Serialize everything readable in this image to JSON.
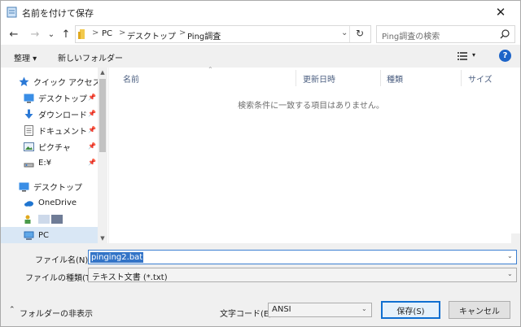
{
  "window": {
    "title": "名前を付けて保存"
  },
  "nav": {
    "back_glyph": "←",
    "forward_glyph": "→",
    "recent_glyph": "⌄",
    "up_glyph": "↑",
    "breadcrumb": [
      "PC",
      "デスクトップ",
      "Ping調査"
    ],
    "breadcrumb_sep": ">",
    "dropdown_glyph": "⌄",
    "refresh_glyph": "↻",
    "search_placeholder": "Ping調査の検索"
  },
  "toolbar": {
    "organize": "整理 ▾",
    "new_folder": "新しいフォルダー",
    "view_caret": "▾",
    "help": "?"
  },
  "sidebar": {
    "items": [
      {
        "label": "クイック アクセス",
        "icon": "star-icon"
      },
      {
        "label": "デスクトップ",
        "icon": "desktop-icon",
        "pinned": true
      },
      {
        "label": "ダウンロード",
        "icon": "download-icon",
        "pinned": true
      },
      {
        "label": "ドキュメント",
        "icon": "document-icon",
        "pinned": true
      },
      {
        "label": "ピクチャ",
        "icon": "pictures-icon",
        "pinned": true
      },
      {
        "label": "E:¥",
        "icon": "drive-icon",
        "pinned": true
      },
      {
        "label": "デスクトップ",
        "icon": "desktop-icon"
      },
      {
        "label": "OneDrive",
        "icon": "cloud-icon"
      },
      {
        "label": "",
        "icon": "user-icon"
      },
      {
        "label": "PC",
        "icon": "pc-icon"
      }
    ],
    "pin_glyph": "📌"
  },
  "table": {
    "columns": [
      "名前",
      "更新日時",
      "種類",
      "サイズ"
    ],
    "sort_glyph": "⌃",
    "empty_message": "検索条件に一致する項目はありません。"
  },
  "form": {
    "filename_label": "ファイル名(N):",
    "filename_value": "pinging2.bat",
    "filetype_label": "ファイルの種類(T):",
    "filetype_value": "テキスト文書 (*.txt)",
    "encoding_label": "文字コード(E):",
    "encoding_value": "ANSI",
    "combo_caret": "⌄"
  },
  "footer": {
    "hide_folders": "フォルダーの非表示",
    "hide_glyph": "⌃",
    "save": "保存(S)",
    "cancel": "キャンセル"
  },
  "colors": {
    "accent": "#0f6fd1",
    "selection": "#3374c7",
    "header_text": "#4d6082"
  }
}
